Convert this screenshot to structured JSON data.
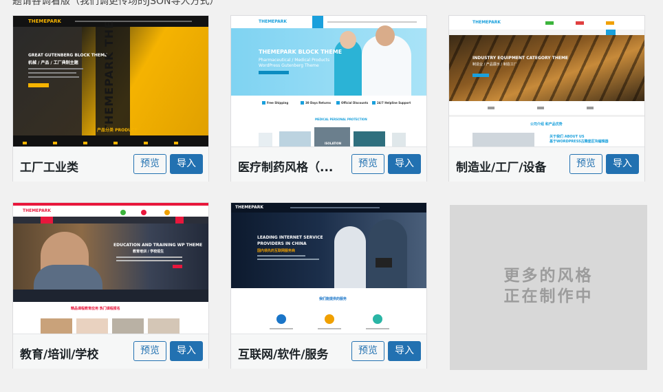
{
  "header_note": "题请各调看版（我们调更传场的JSON导人方式）",
  "buttons": {
    "preview": "预览",
    "import": "导入"
  },
  "cards": [
    {
      "title": "工厂工业类",
      "thumb": {
        "logo": "THEMEPARK",
        "headline": "GREAT GUTENBERG BLOCK THEME",
        "subhead": "机械 / 产品 / 工厂典制主题",
        "side_text": "THEMEPARK THE BEST THEME",
        "section": "产品分类 PRODUCT"
      }
    },
    {
      "title": "医疗制药风格（...",
      "thumb": {
        "logo": "THEMEPARK",
        "headline": "THEMEPARK BLOCK THEME",
        "subhead": "Pharmaceutical / Medical Products",
        "subhead2": "WordPress Gutenberg Theme",
        "features": [
          "Free Shipping",
          "30 Days Returns",
          "Official Discounts",
          "24/7 Helpline Support"
        ],
        "section": "MEDICAL PERSONAL PROTECTION",
        "tag": "ISOLATION"
      }
    },
    {
      "title": "制造业/工厂/设备",
      "thumb": {
        "logo": "THEMEPARK",
        "headline": "INDUSTRY EQUIPMENT CATEGORY THEME",
        "subhead": "制造业 / 产品展示 / 制造工厂",
        "section": "公司介绍 和产品优势",
        "about": "关于我们 ABOUT US",
        "about2": "基于WORDPRESS古腾堡区块编辑器"
      }
    },
    {
      "title": "教育/培训/学校",
      "thumb": {
        "logo": "THEMEPARK",
        "headline": "EDUCATION AND TRAINING WP THEME",
        "subhead": "教育培训 / 学校招生",
        "section": "精品课程教育应用 热门课程报名"
      }
    },
    {
      "title": "互联网/软件/服务",
      "thumb": {
        "logo": "THEMEPARK",
        "headline": "LEADING INTERNET SERVICE PROVIDERS IN CHINA",
        "subhead": "国内领先的互联网服务商",
        "section": "我们能提供的服务"
      }
    }
  ],
  "more": {
    "line1": "更多的风格",
    "line2": "正在制作中"
  },
  "colors": {
    "accent": "#2271b1",
    "industrial": "#f5b301",
    "medical": "#1aa0dc",
    "education": "#e8173c",
    "internet_bg": "#0d1a2e"
  }
}
